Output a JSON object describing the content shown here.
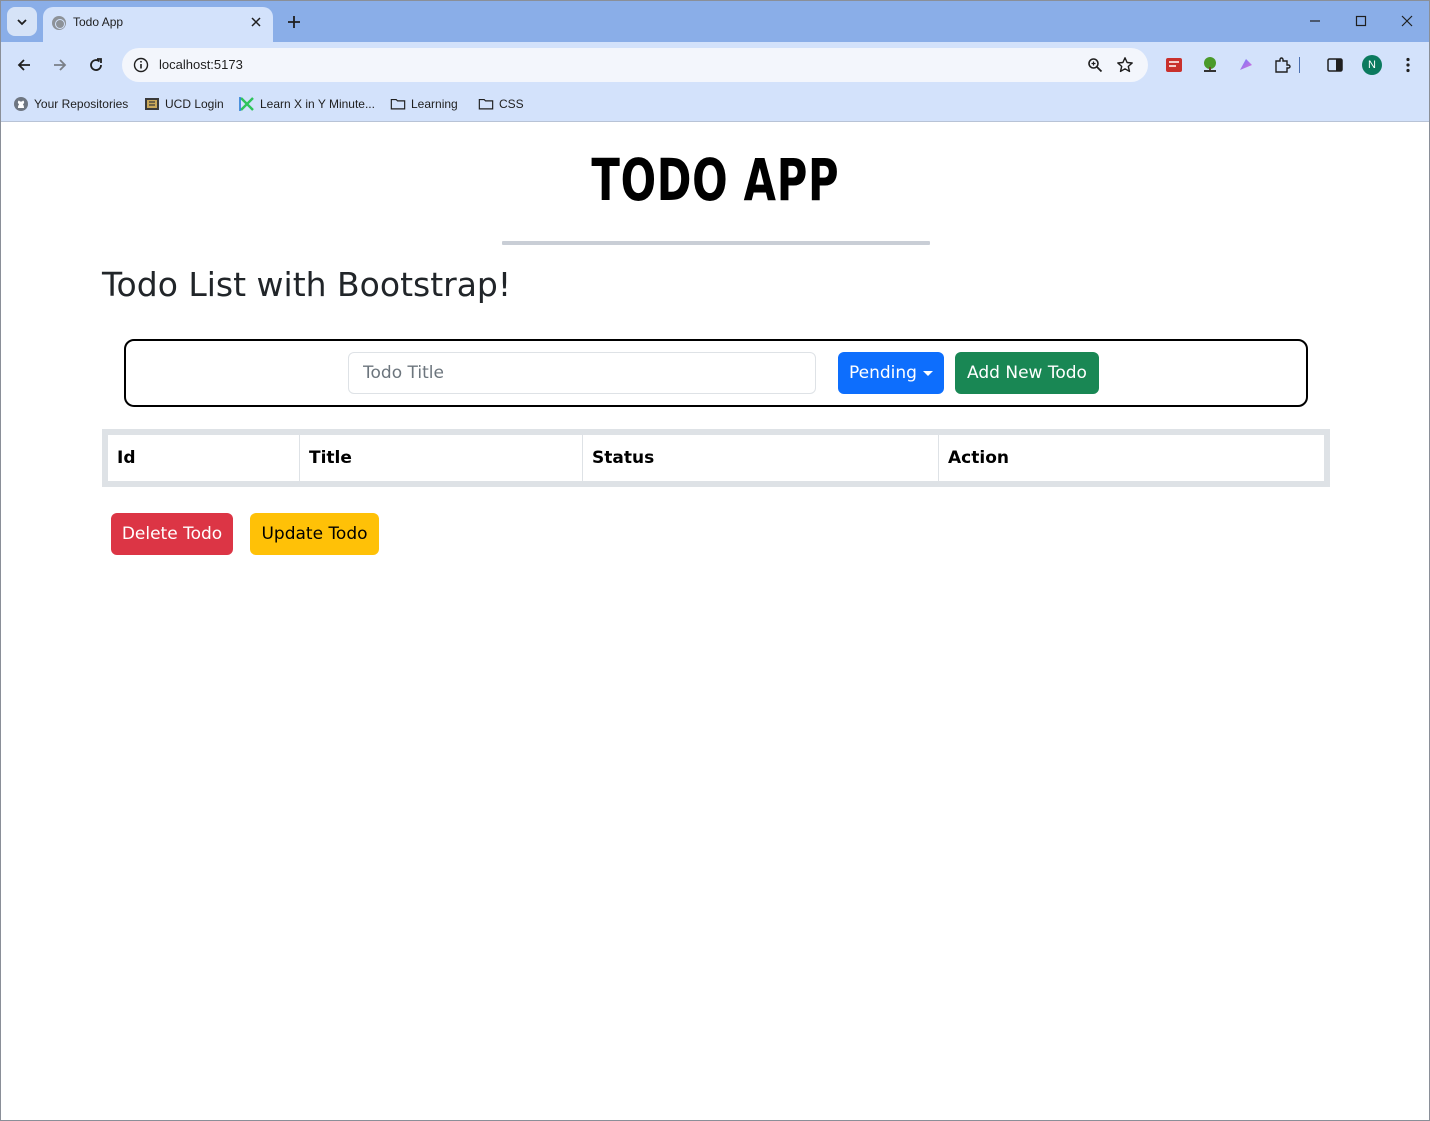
{
  "browser": {
    "tab": {
      "title": "Todo App"
    },
    "omnibox": {
      "url": "localhost:5173"
    },
    "profile_initial": "N",
    "bookmarks": [
      {
        "label": "Your Repositories",
        "icon": "github-icon"
      },
      {
        "label": "UCD Login",
        "icon": "ucd-icon"
      },
      {
        "label": "Learn X in Y Minute...",
        "icon": "learnx-icon"
      },
      {
        "label": "Learning",
        "icon": "folder-icon"
      },
      {
        "label": "CSS",
        "icon": "folder-icon"
      }
    ]
  },
  "app": {
    "title": "TODO APP",
    "subheading": "Todo List with Bootstrap!",
    "form": {
      "input_placeholder": "Todo Title",
      "input_value": "",
      "status_selected": "Pending",
      "add_button": "Add New Todo"
    },
    "table": {
      "columns": [
        "Id",
        "Title",
        "Status",
        "Action"
      ],
      "rows": []
    },
    "actions": {
      "delete_button": "Delete Todo",
      "update_button": "Update Todo"
    }
  },
  "colors": {
    "primary": "#0d6efd",
    "success": "#198754",
    "danger": "#dc3545",
    "warning": "#ffc107",
    "tabstrip": "#8aaee8",
    "toolbar": "#d3e2fb"
  }
}
